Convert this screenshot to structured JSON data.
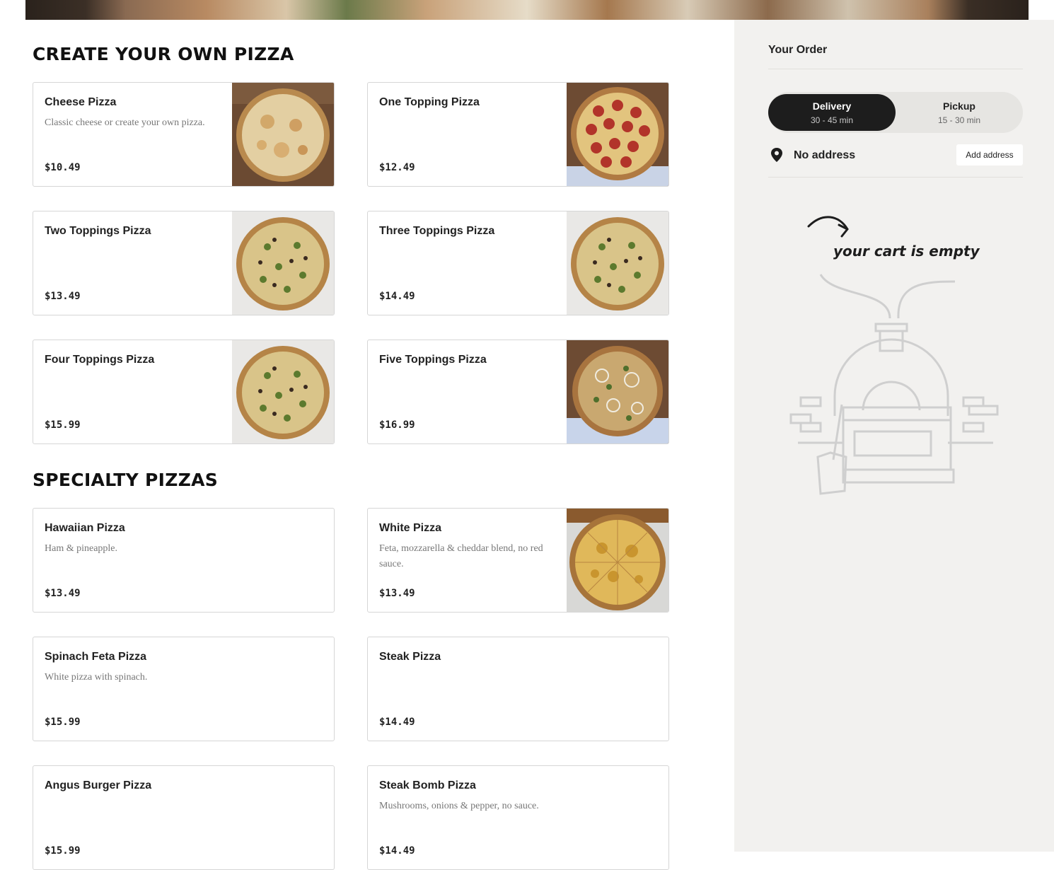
{
  "sections": [
    {
      "title": "CREATE YOUR OWN PIZZA",
      "items": [
        {
          "name": "Cheese Pizza",
          "description": "Classic cheese or create your own pizza.",
          "price": "$10.49",
          "image": "cheese-pizza-photo"
        },
        {
          "name": "One Topping Pizza",
          "description": "",
          "price": "$12.49",
          "image": "pepperoni-pizza-photo"
        },
        {
          "name": "Two Toppings Pizza",
          "description": "",
          "price": "$13.49",
          "image": "veggie-pizza-photo"
        },
        {
          "name": "Three Toppings Pizza",
          "description": "",
          "price": "$14.49",
          "image": "veggie-pizza-photo"
        },
        {
          "name": "Four Toppings Pizza",
          "description": "",
          "price": "$15.99",
          "image": "veggie-pizza-photo"
        },
        {
          "name": "Five Toppings Pizza",
          "description": "",
          "price": "$16.99",
          "image": "supreme-pizza-photo"
        }
      ]
    },
    {
      "title": "SPECIALTY PIZZAS",
      "items": [
        {
          "name": "Hawaiian Pizza",
          "description": "Ham & pineapple.",
          "price": "$13.49"
        },
        {
          "name": "White Pizza",
          "description": "Feta, mozzarella & cheddar blend, no red sauce.",
          "price": "$13.49",
          "image": "white-pizza-photo"
        },
        {
          "name": "Spinach Feta Pizza",
          "description": "White pizza with spinach.",
          "price": "$15.99"
        },
        {
          "name": "Steak Pizza",
          "description": "",
          "price": "$14.49"
        },
        {
          "name": "Angus Burger Pizza",
          "description": "",
          "price": "$15.99"
        },
        {
          "name": "Steak Bomb Pizza",
          "description": "Mushrooms, onions & pepper, no sauce.",
          "price": "$14.49"
        }
      ]
    }
  ],
  "order": {
    "title": "Your Order",
    "delivery": {
      "label": "Delivery",
      "time": "30 - 45 min",
      "selected": true
    },
    "pickup": {
      "label": "Pickup",
      "time": "15 - 30 min",
      "selected": false
    },
    "address_label": "No address",
    "add_address_button": "Add address",
    "empty_text": "your cart is empty",
    "icons": {
      "pin": "location-pin-icon",
      "illustration": "pizza-oven-illustration",
      "arrow": "curved-arrow-icon"
    }
  },
  "colors": {
    "accent_dark": "#1d1d1d",
    "sidebar_bg": "#f2f1ef",
    "card_border": "#d6d6d6"
  }
}
